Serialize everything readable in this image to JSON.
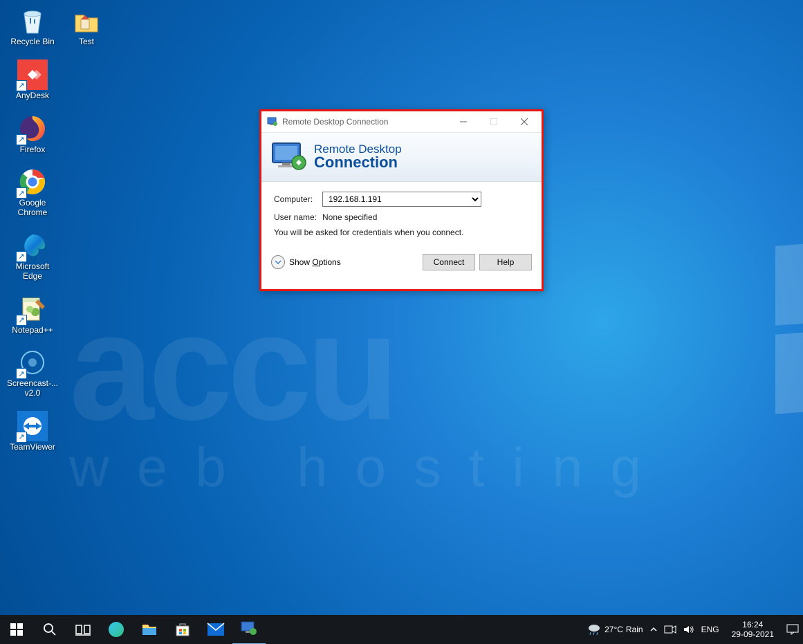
{
  "desktop_icons": [
    {
      "id": "recycle-bin",
      "label": "Recycle Bin",
      "shortcut": false
    },
    {
      "id": "test-folder",
      "label": "Test",
      "shortcut": false
    },
    {
      "id": "anydesk",
      "label": "AnyDesk",
      "shortcut": true
    },
    {
      "id": "firefox",
      "label": "Firefox",
      "shortcut": true
    },
    {
      "id": "chrome",
      "label": "Google\nChrome",
      "shortcut": true
    },
    {
      "id": "edge",
      "label": "Microsoft\nEdge",
      "shortcut": true
    },
    {
      "id": "notepadpp",
      "label": "Notepad++",
      "shortcut": true
    },
    {
      "id": "screencast",
      "label": "Screencast-...\nv2.0",
      "shortcut": true
    },
    {
      "id": "teamviewer",
      "label": "TeamViewer",
      "shortcut": true
    }
  ],
  "rdc": {
    "title": "Remote Desktop Connection",
    "banner_line1": "Remote Desktop",
    "banner_line2": "Connection",
    "computer_label": "Computer:",
    "computer_value": "192.168.1.191",
    "username_label": "User name:",
    "username_value": "None specified",
    "hint": "You will be asked for credentials when you connect.",
    "show_options": "Show Options",
    "connect": "Connect",
    "help": "Help"
  },
  "taskbar": {
    "weather_temp": "27°C",
    "weather_cond": "Rain",
    "lang": "ENG",
    "time": "16:24",
    "date": "29-09-2021"
  },
  "watermark": {
    "l1": "accu",
    "l2": "web hosting"
  }
}
